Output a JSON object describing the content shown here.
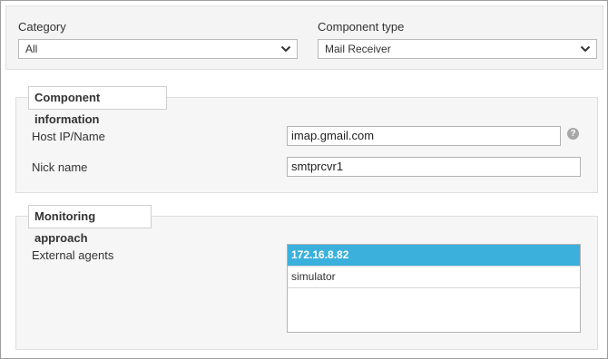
{
  "top": {
    "category": {
      "label": "Category",
      "value": "All"
    },
    "component_type": {
      "label": "Component type",
      "value": "Mail Receiver"
    }
  },
  "component_info": {
    "legend": "Component information",
    "host": {
      "label": "Host IP/Name",
      "value": "imap.gmail.com",
      "help_icon": "?"
    },
    "nick": {
      "label": "Nick name",
      "value": "smtprcvr1"
    }
  },
  "monitoring": {
    "legend": "Monitoring approach",
    "external_agents": {
      "label": "External agents",
      "items": [
        {
          "label": "172.16.8.82",
          "selected": true
        },
        {
          "label": "simulator",
          "selected": false
        }
      ]
    }
  },
  "colors": {
    "selected_row": "#3bb0dc",
    "panel_bg": "#f4f4f4"
  },
  "icons": [
    "chevron-down-icon",
    "help-icon"
  ]
}
